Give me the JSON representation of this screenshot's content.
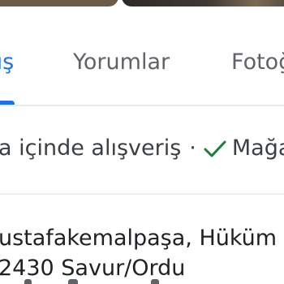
{
  "tabs": [
    {
      "label": "uş",
      "selected": true
    },
    {
      "label": "Yorumlar",
      "selected": false
    },
    {
      "label": "Fotoğ",
      "selected": false
    }
  ],
  "service_options": {
    "first": "a içinde alışveriş",
    "separator": "·",
    "second": "Mağa",
    "check_icon": "check-icon"
  },
  "address": {
    "line1": "ustafakemalpaşa, Hüküm",
    "line2": "2430 Savur/Ordu"
  },
  "colors": {
    "accent": "#1a73e8",
    "check": "#188038",
    "text": "#3c4043",
    "muted": "#5f6368"
  }
}
